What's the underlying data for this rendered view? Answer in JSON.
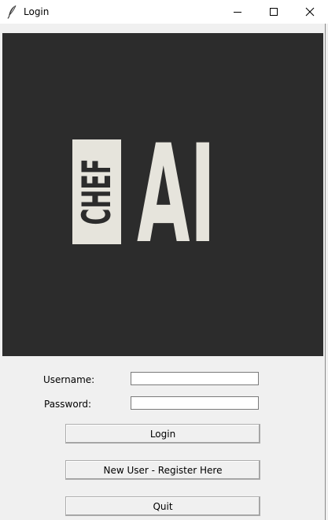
{
  "window": {
    "title": "Login",
    "icon": "feather-icon",
    "controls": [
      "minimize-icon",
      "maximize-icon",
      "close-icon"
    ]
  },
  "logo": {
    "vertical_word": "CHEF",
    "big_word": "AI",
    "background_color": "#2c2c2c",
    "foreground_color": "#e6e4dc"
  },
  "form": {
    "username_label": "Username:",
    "username_value": "",
    "password_label": "Password:",
    "password_value": ""
  },
  "buttons": {
    "login": "Login",
    "register": "New User - Register Here",
    "quit": "Quit"
  }
}
